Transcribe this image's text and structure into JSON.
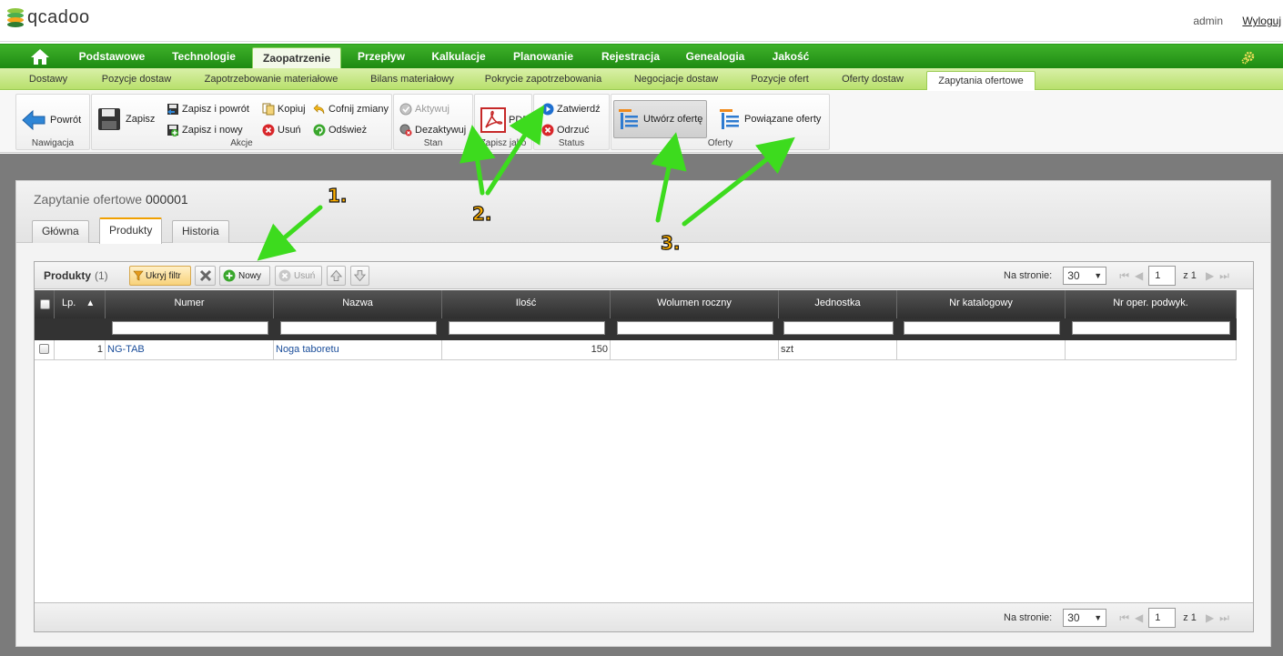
{
  "app": {
    "logo_text": "qcadoo",
    "user": "admin",
    "logout_label": "Wyloguj"
  },
  "main_nav": {
    "items": [
      "Podstawowe",
      "Technologie",
      "Zaopatrzenie",
      "Przepływ",
      "Kalkulacje",
      "Planowanie",
      "Rejestracja",
      "Genealogia",
      "Jakość"
    ],
    "active": "Zaopatrzenie"
  },
  "sub_nav": {
    "items": [
      "Dostawy",
      "Pozycje dostaw",
      "Zapotrzebowanie materiałowe",
      "Bilans materiałowy",
      "Pokrycie zapotrzebowania",
      "Negocjacje dostaw",
      "Pozycje ofert",
      "Oferty dostaw",
      "Zapytania ofertowe"
    ],
    "active": "Zapytania ofertowe"
  },
  "ribbon": {
    "nav": {
      "label": "Nawigacja",
      "back": "Powrót"
    },
    "actions": {
      "label": "Akcje",
      "save": "Zapisz",
      "save_back": "Zapisz i powrót",
      "save_new": "Zapisz i nowy",
      "copy": "Kopiuj",
      "delete": "Usuń",
      "undo": "Cofnij zmiany",
      "refresh": "Odśwież"
    },
    "state": {
      "label": "Stan",
      "activate": "Aktywuj",
      "deactivate": "Dezaktywuj"
    },
    "save_as": {
      "label": "Zapisz jako",
      "pdf": "PDF"
    },
    "status": {
      "label": "Status",
      "approve": "Zatwierdź",
      "reject": "Odrzuć"
    },
    "offers": {
      "label": "Oferty",
      "create": "Utwórz ofertę",
      "related": "Powiązane oferty"
    }
  },
  "form": {
    "title_prefix": "Zapytanie ofertowe",
    "title_number": "000001",
    "tabs": [
      "Główna",
      "Produkty",
      "Historia"
    ],
    "active_tab": "Produkty"
  },
  "grid": {
    "title": "Produkty",
    "count": "(1)",
    "toolbar": {
      "hide_filter": "Ukryj filtr",
      "new": "Nowy",
      "delete": "Usuń"
    },
    "pager": {
      "per_page_label": "Na stronie:",
      "per_page": "30",
      "page": "1",
      "of": "z 1"
    },
    "columns": [
      "Lp.",
      "Numer",
      "Nazwa",
      "Ilość",
      "Wolumen roczny",
      "Jednostka",
      "Nr katalogowy",
      "Nr oper. podwyk."
    ],
    "rows": [
      {
        "lp": "1",
        "numer": "NG-TAB",
        "nazwa": "Noga taboretu",
        "ilosc": "150",
        "wolumen": "",
        "jednostka": "szt",
        "katalog": "",
        "oper": ""
      }
    ]
  },
  "annotations": {
    "n1": "1.",
    "n2": "2.",
    "n3": "3."
  },
  "colors": {
    "nav_green": "#2a9c1a",
    "subnav_green": "#c4e585",
    "arrow_green": "#3ddb1e",
    "annotation_orange": "#ffb000"
  }
}
